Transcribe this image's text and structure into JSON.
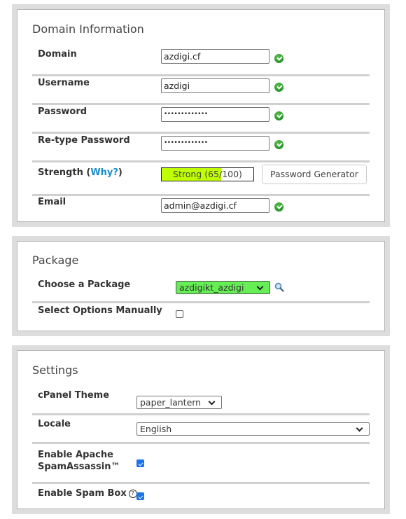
{
  "domain_info": {
    "title": "Domain Information",
    "domain": {
      "label": "Domain",
      "value": "azdigi.cf",
      "status_icon": "check-ok-icon"
    },
    "username": {
      "label": "Username",
      "value": "azdigi",
      "status_icon": "check-ok-icon"
    },
    "password": {
      "label": "Password",
      "value": "•••••••••••••",
      "status_icon": "check-ok-icon"
    },
    "retype_password": {
      "label": "Re-type Password",
      "value": "•••••••••••••",
      "status_icon": "check-ok-icon"
    },
    "strength": {
      "label": "Strength (",
      "link": "Why?",
      "label_end": ")",
      "meter_text": "Strong (65/100)",
      "score": 65,
      "max": 100,
      "fill_color": "#c0ff00"
    },
    "password_generator_label": "Password Generator",
    "email": {
      "label": "Email",
      "value": "admin@azdigi.cf",
      "status_icon": "check-ok-icon"
    }
  },
  "package": {
    "title": "Package",
    "choose_label": "Choose a Package",
    "selected_package": "azdigikt_azdigi",
    "select_color": "#66ee55",
    "manual_label": "Select Options Manually",
    "manual_checked": false
  },
  "settings": {
    "title": "Settings",
    "theme_label": "cPanel Theme",
    "theme_value": "paper_lantern",
    "locale_label": "Locale",
    "locale_value": "English",
    "spamassassin_label_1": "Enable Apache",
    "spamassassin_label_2": "SpamAssassin™",
    "spamassassin_checked": true,
    "spambox_label": "Enable Spam Box",
    "spambox_help_icon": "?",
    "spambox_checked": true
  }
}
